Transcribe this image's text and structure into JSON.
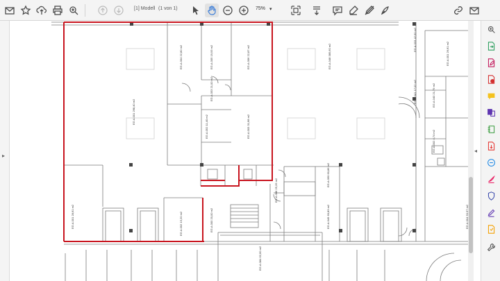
{
  "toolbar": {
    "page_indicator": "[1] Modell",
    "page_count": "(1 von 1)",
    "zoom_value": "75%",
    "zoom_caret": "▾"
  },
  "icons": {
    "left": [
      "mail-icon",
      "bookmark-star-icon",
      "upload-icon",
      "print-icon",
      "search-zoom-icon",
      "page-up-icon",
      "page-down-icon",
      "select-cursor-icon",
      "hand-tool-icon",
      "zoom-out-icon",
      "zoom-in-icon",
      "fit-page-icon",
      "scroll-mode-icon"
    ],
    "right": [
      "comment-icon",
      "highlight-pen-icon",
      "sign-edit-icon",
      "draw-icon",
      "share-link-icon",
      "mail-send-icon"
    ],
    "rightpanel": [
      "search-zoom-icon",
      "export-pdf-icon",
      "edit-pdf-icon",
      "create-pdf-icon",
      "comment-panel-icon",
      "combine-files-icon",
      "organize-pages-icon",
      "compress-pdf-icon",
      "redact-icon",
      "protect-icon",
      "fill-sign-icon",
      "scan-icon",
      "more-tools-icon"
    ]
  },
  "colors": {
    "accent": "#3b7dd8",
    "highlight_red": "#c8141e",
    "plan_line": "#7a7a7a"
  },
  "plan": {
    "rooms": [
      {
        "id": "EG.A.001",
        "area": "268,40 m2"
      },
      {
        "id": "EG.A.004",
        "area": "22,80 m2"
      },
      {
        "id": "EG.A.005",
        "area": "19,93 m2"
      },
      {
        "id": "EG.A.006",
        "area": "22,87 m2"
      },
      {
        "id": "EG.A.053",
        "area": "21,00 m2"
      },
      {
        "id": "EG.A.052",
        "area": "11,40 m2"
      },
      {
        "id": "EG.A.003",
        "area": "31,68 m2"
      },
      {
        "id": "EG.A.001",
        "area": "28,61 m2"
      },
      {
        "id": "EG.A.002",
        "area": "15,20 m2"
      },
      {
        "id": "EG.A.000",
        "area": "20,00 m2"
      },
      {
        "id": "EG.A.048",
        "area": "385,60 m2"
      },
      {
        "id": "EG.A.050",
        "area": "60,86 m2"
      },
      {
        "id": "EG.A.008",
        "area": "25,26 m2"
      },
      {
        "id": "EG.A.049",
        "area": "60,83 m2"
      },
      {
        "id": "EG.A.084",
        "area": "62,60 m2"
      },
      {
        "id": "EG.A.033",
        "area": "42,60 m2"
      },
      {
        "id": "EG.A.041",
        "area": "17,02 m2"
      },
      {
        "id": "EG.A.040",
        "area": "21,79 m2"
      },
      {
        "id": "EG.A.001",
        "area": "26,61 m2"
      },
      {
        "id": "EG.A.002",
        "area": "4,74 m2"
      },
      {
        "id": "EG.A.004",
        "area": "50,97 m2"
      }
    ]
  }
}
